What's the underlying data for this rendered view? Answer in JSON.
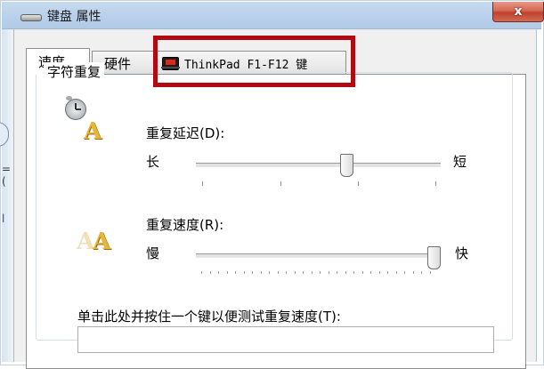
{
  "window": {
    "title": "键盘 属性",
    "close_glyph": "x"
  },
  "background_window": {
    "sliver_text_1": "=(",
    "sliver_text_2": "l"
  },
  "tabs": [
    {
      "label": "速度",
      "selected": true
    },
    {
      "label": "硬件",
      "selected": false
    },
    {
      "label": "ThinkPad F1-F12 键",
      "selected": false
    }
  ],
  "group": {
    "title": "字符重复"
  },
  "repeat_delay": {
    "label": "重复延迟(D):",
    "left_label": "长",
    "right_label": "短",
    "value": 0.62
  },
  "repeat_rate": {
    "label": "重复速度(R):",
    "left_label": "慢",
    "right_label": "快",
    "value": 1.0
  },
  "test": {
    "label": "单击此处并按住一个键以便测试重复速度(T):",
    "value": ""
  },
  "colors": {
    "highlight": "#b00b12",
    "close_button": "#c0412b",
    "titlebar": "#b9d0ea"
  }
}
